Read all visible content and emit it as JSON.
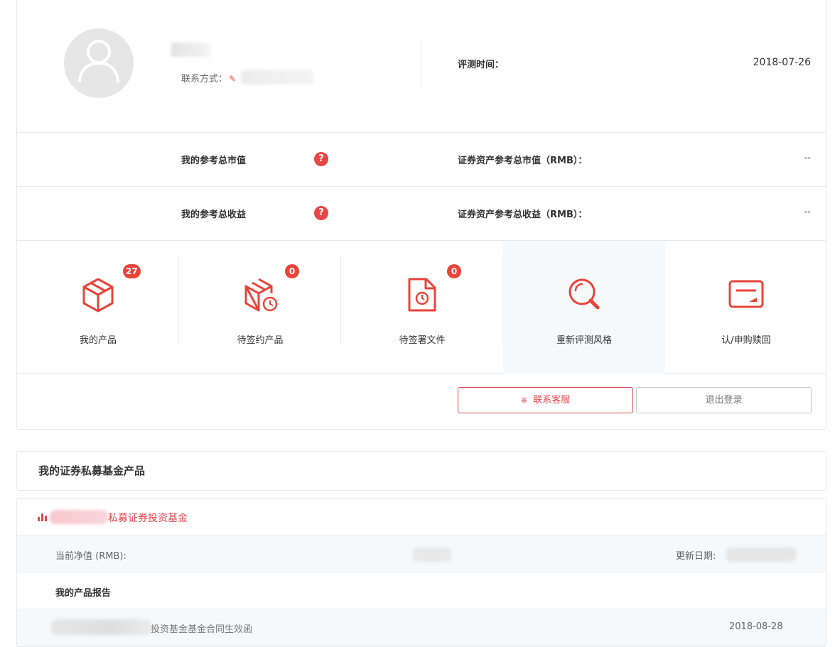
{
  "profile": {
    "contact_label": "联系方式：",
    "eval_time_label": "评测时间：",
    "eval_date": "2018-07-26"
  },
  "stats": [
    {
      "label": "我的参考总市值",
      "help": "?",
      "right_label": "证券资产参考总市值（RMB）：",
      "value": "--"
    },
    {
      "label": "我的参考总收益",
      "help": "?",
      "right_label": "证券资产参考总收益（RMB）：",
      "value": "--"
    }
  ],
  "quick_actions": [
    {
      "label": "我的产品",
      "badge": "27",
      "icon": "cube-icon"
    },
    {
      "label": "待签约产品",
      "badge": "0",
      "icon": "cube-clock-icon"
    },
    {
      "label": "待签署文件",
      "badge": "0",
      "icon": "document-clock-icon"
    },
    {
      "label": "重新评测风格",
      "badge": "",
      "icon": "magnifier-icon"
    },
    {
      "label": "认/申购赎回",
      "badge": "",
      "icon": "card-icon"
    }
  ],
  "buttons": {
    "service_label": "联系客服",
    "logout_label": "退出登录"
  },
  "fund_section": {
    "title": "我的证券私募基金产品",
    "fund_name_suffix": "私募证券投资基金",
    "nav_label": "当前净值 (RMB):",
    "update_label": "更新日期:",
    "report_title": "我的产品报告",
    "doc_name_suffix": "投资基金基金合同生效函",
    "doc_date": "2018-08-28"
  },
  "colors": {
    "accent": "#e8443a",
    "border": "#e8e8e8",
    "highlight_bg": "#f7f8fa"
  }
}
